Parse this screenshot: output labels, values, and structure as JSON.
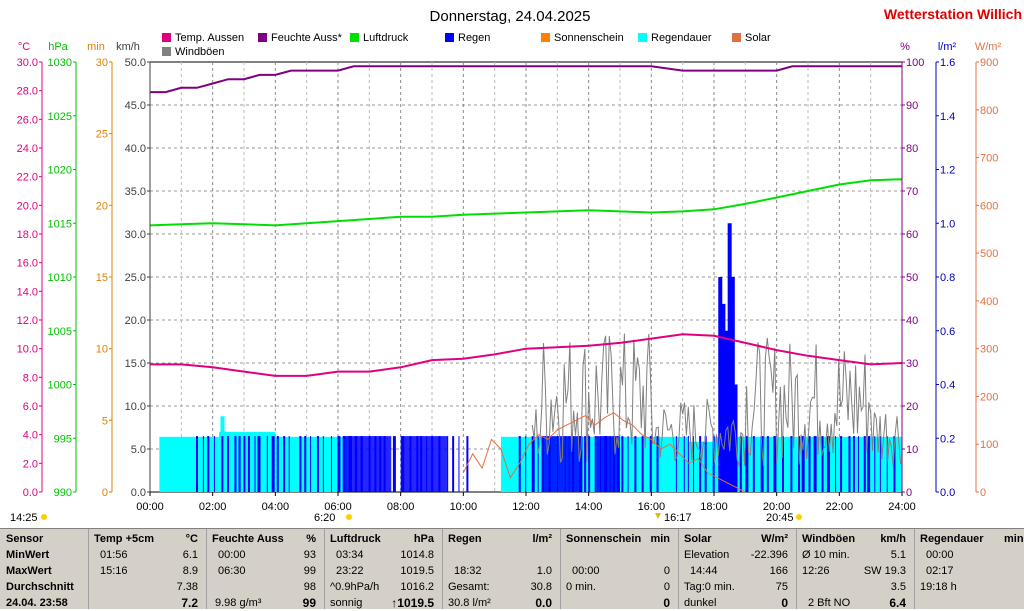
{
  "title": "Donnerstag, 24.04.2025",
  "station": "Wetterstation Willich",
  "colors": {
    "temp": "#e0007f",
    "humidity": "#800080",
    "pressure": "#00e000",
    "rain": "#0000ff",
    "sunshine": "#ff8000",
    "rain_duration": "#00ffff",
    "solar": "#e07040",
    "gust": "#808080"
  },
  "legend": [
    {
      "key": "temp",
      "label": "Temp. Aussen"
    },
    {
      "key": "humidity",
      "label": "Feuchte Auss*"
    },
    {
      "key": "pressure",
      "label": "Luftdruck"
    },
    {
      "key": "rain",
      "label": "Regen"
    },
    {
      "key": "sunshine",
      "label": "Sonnenschein"
    },
    {
      "key": "rain_duration",
      "label": "Regendauer"
    },
    {
      "key": "solar",
      "label": "Solar"
    },
    {
      "key": "gust",
      "label": "Windböen"
    }
  ],
  "axis_units": {
    "temp": "°C",
    "pressure": "hPa",
    "minutes": "min",
    "wind": "km/h",
    "humidity": "%",
    "rain": "l/m²",
    "solar": "W/m²"
  },
  "chart_data": {
    "type": "line",
    "x_label_ticks": [
      "00:00",
      "02:00",
      "04:00",
      "06:00",
      "08:00",
      "10:00",
      "12:00",
      "14:00",
      "16:00",
      "18:00",
      "20:00",
      "22:00",
      "24:00"
    ],
    "x_range_hours": [
      0,
      24
    ],
    "axes": {
      "temp": {
        "range": [
          0,
          30
        ],
        "ticks": [
          "0.0",
          "2.0",
          "4.0",
          "6.0",
          "8.0",
          "10.0",
          "12.0",
          "14.0",
          "16.0",
          "18.0",
          "20.0",
          "22.0",
          "24.0",
          "26.0",
          "28.0",
          "30.0"
        ]
      },
      "pressure": {
        "range": [
          990,
          1030
        ],
        "ticks": [
          "990",
          "995",
          "1000",
          "1005",
          "1010",
          "1015",
          "1020",
          "1025",
          "1030"
        ]
      },
      "minutes": {
        "range": [
          0,
          30
        ],
        "ticks": [
          "0",
          "5",
          "10",
          "15",
          "20",
          "25",
          "30"
        ]
      },
      "wind": {
        "range": [
          0,
          50
        ],
        "ticks": [
          "0.0",
          "5.0",
          "10.0",
          "15.0",
          "20.0",
          "25.0",
          "30.0",
          "35.0",
          "40.0",
          "45.0",
          "50.0"
        ]
      },
      "humidity": {
        "range": [
          0,
          100
        ],
        "ticks": [
          "0",
          "10",
          "20",
          "30",
          "40",
          "50",
          "60",
          "70",
          "80",
          "90",
          "100"
        ]
      },
      "rain": {
        "range": [
          0,
          1.6
        ],
        "ticks": [
          "0.0",
          "0.2",
          "0.4",
          "0.6",
          "0.8",
          "1.0",
          "1.2",
          "1.4",
          "1.6"
        ]
      },
      "solar": {
        "range": [
          0,
          900
        ],
        "ticks": [
          "0",
          "100",
          "200",
          "300",
          "400",
          "500",
          "600",
          "700",
          "800",
          "900"
        ]
      }
    },
    "series": [
      {
        "name": "Temp. Aussen",
        "axis": "temp",
        "x": [
          0,
          1,
          2,
          3,
          4,
          5,
          6,
          7,
          8,
          9,
          10,
          11,
          12,
          13,
          14,
          15,
          16,
          17,
          18,
          19,
          20,
          21,
          22,
          23,
          24
        ],
        "y": [
          8.9,
          8.9,
          8.7,
          8.4,
          8.1,
          8.1,
          8.4,
          8.4,
          8.7,
          9.2,
          9.3,
          9.6,
          10.0,
          10.1,
          10.2,
          10.4,
          10.7,
          11.0,
          10.9,
          10.4,
          9.9,
          9.5,
          9.2,
          8.9,
          9.0
        ]
      },
      {
        "name": "Feuchte Auss*",
        "axis": "humidity",
        "x": [
          0,
          0.5,
          1,
          1.5,
          2,
          2.5,
          3,
          3.5,
          4,
          4.5,
          5,
          5.5,
          6,
          6.5,
          7,
          8,
          10,
          12,
          14,
          16,
          17,
          18,
          20,
          20.5,
          21,
          22,
          24
        ],
        "y": [
          93,
          93,
          94,
          94,
          95,
          96,
          96,
          97,
          97,
          98,
          98,
          98,
          98,
          99,
          99,
          99,
          99,
          99,
          99,
          99,
          98,
          98,
          98,
          99,
          99,
          99,
          99
        ]
      },
      {
        "name": "Luftdruck",
        "axis": "pressure",
        "x": [
          0,
          1,
          2,
          3,
          4,
          5,
          6,
          7,
          8,
          9,
          10,
          11,
          12,
          13,
          14,
          15,
          16,
          17,
          18,
          19,
          20,
          21,
          22,
          23,
          24
        ],
        "y": [
          1014.8,
          1014.9,
          1015.0,
          1014.9,
          1014.8,
          1015.0,
          1015.2,
          1015.4,
          1015.6,
          1015.6,
          1015.8,
          1015.9,
          1016.0,
          1016.1,
          1016.2,
          1016.1,
          1016.0,
          1016.1,
          1016.3,
          1016.8,
          1017.4,
          1018.0,
          1018.6,
          1019.0,
          1019.1
        ]
      },
      {
        "name": "Solar",
        "axis": "solar",
        "x": [
          10.0,
          10.3,
          10.6,
          10.9,
          11.2,
          11.5,
          11.8,
          12.1,
          12.4,
          12.7,
          13.0,
          13.3,
          13.6,
          13.9,
          14.2,
          14.5,
          14.8,
          15.1,
          15.4,
          15.7,
          16.0,
          16.3,
          16.6,
          16.9,
          17.2,
          17.5,
          17.8,
          18.1,
          18.4,
          18.7,
          19.0
        ],
        "y": [
          40,
          80,
          50,
          110,
          90,
          30,
          60,
          100,
          120,
          110,
          130,
          140,
          150,
          160,
          140,
          155,
          166,
          150,
          140,
          120,
          110,
          90,
          100,
          80,
          60,
          70,
          40,
          30,
          20,
          10,
          0
        ]
      }
    ],
    "rain_bars": {
      "axis": "rain",
      "x": [
        18.2,
        18.3,
        18.4,
        18.5,
        18.6
      ],
      "y": [
        0.8,
        0.7,
        0.6,
        1.0,
        0.8
      ]
    },
    "summary": {
      "rain_total": "1.0"
    }
  },
  "markers": {
    "left_time": "14:25",
    "sunrise": "6:20",
    "noon": "16:17",
    "sunset": "20:45"
  },
  "table": {
    "row_labels": [
      "Sensor",
      "MinWert",
      "MaxWert",
      "Durchschnitt",
      "24.04. 23:58"
    ],
    "temp": {
      "header": "Temp +5cm",
      "unit": "°C",
      "min_time": "01:56",
      "min": "6.1",
      "max_time": "15:16",
      "max": "8.9",
      "avg": "7.38",
      "cur": "7.2"
    },
    "hum": {
      "header": "Feuchte Auss",
      "unit": "%",
      "min_time": "00:00",
      "min": "93",
      "max_time": "06:30",
      "max": "99",
      "avg": "98",
      "cur_extra": "9.98 g/m³",
      "cur": "99"
    },
    "press": {
      "header": "Luftdruck",
      "unit": "hPa",
      "min_time": "03:34",
      "min": "1014.8",
      "max_time": "23:22",
      "max": "1019.5",
      "avg_label": "^0.9hPa/h",
      "avg": "1016.2",
      "cur_extra": "sonnig",
      "cur": "↑1019.5"
    },
    "rain": {
      "header": "Regen",
      "unit": "l/m²",
      "max_time": "18:32",
      "max": "1.0",
      "avg_label": "Gesamt:",
      "avg": "30.8",
      "cur_extra": "30.8 l/m²",
      "cur": "0.0"
    },
    "sun": {
      "header": "Sonnenschein",
      "unit": "min",
      "max_time": "00:00",
      "max": "0",
      "avg_label": "0 min.",
      "avg": "0",
      "cur": "0"
    },
    "solar": {
      "header": "Solar",
      "unit": "W/m²",
      "min_label": "Elevation",
      "min": "-22.396",
      "max_time": "14:44",
      "max": "166",
      "avg_label": "Tag:0 min.",
      "avg": "75",
      "cur_extra": "dunkel",
      "cur": "0"
    },
    "gust": {
      "header": "Windböen",
      "unit": "km/h",
      "min_label": "Ø 10 min.",
      "min": "5.1",
      "max_time": "12:26",
      "max": "SW 19.3",
      "avg": "3.5",
      "cur_extra": "2 Bft NO",
      "cur": "6.4"
    },
    "dur": {
      "header": "Regendauer",
      "unit": "min",
      "min_time": "00:00",
      "max_time": "02:17",
      "avg": "19:18 h"
    }
  }
}
